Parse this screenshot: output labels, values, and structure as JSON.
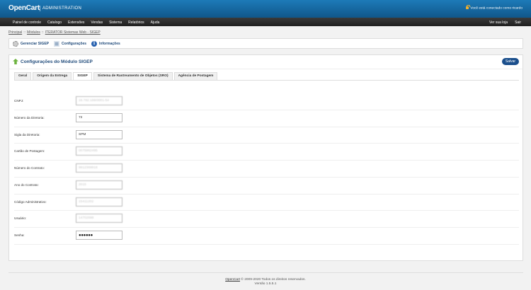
{
  "header": {
    "logo": "OpenCart",
    "subtitle": "ADMINISTRATION",
    "logged_in": "Você está conectado como ricardo"
  },
  "menu": {
    "items": [
      "Painel de controle",
      "Catalogo",
      "Extensões",
      "Vendas",
      "Sistema",
      "Relatórios",
      "Ajuda"
    ],
    "right": [
      "Ver sua loja",
      "Sair"
    ]
  },
  "breadcrumb": [
    "Principal",
    "Módulos",
    "ITERATOR Sistemas Web - SIGEP"
  ],
  "toolbar": {
    "items": [
      "Gerenciar SIGEP",
      "Configurações",
      "Informações"
    ]
  },
  "panel": {
    "title": "Configurações do Módulo SIGEP",
    "save_label": "Salvar"
  },
  "tabs": [
    "Geral",
    "Origem da Entrega",
    "SIGEP",
    "Sistema de Rastreamento de Objetos (SRO)",
    "Agência de Postagem"
  ],
  "active_tab": "SIGEP",
  "form": {
    "rows": [
      {
        "label": "CNPJ:",
        "value": "16.782.188/0001-54"
      },
      {
        "label": "Número da Diretoria:",
        "value": "72"
      },
      {
        "label": "Sigla da Diretoria:",
        "value": "SPM"
      },
      {
        "label": "Cartão de Postagem:",
        "value": "0075962495"
      },
      {
        "label": "Número do Contrato:",
        "value": "9912369918"
      },
      {
        "label": "Ano do Contrato:",
        "value": "2015"
      },
      {
        "label": "Código Administrativo:",
        "value": "15411202"
      },
      {
        "label": "Usuário:",
        "value": "14702698"
      },
      {
        "label": "Senha:",
        "value": "●●●●●●"
      }
    ]
  },
  "footer": {
    "brand": "OpenCart",
    "copyright": "© 2009-2020 Todos os direitos reservados.",
    "version": "Versão 1.5.5.1"
  },
  "colors": {
    "header": "#1469a3",
    "menu": "#2b2b2b",
    "accent": "#1b4f8c",
    "link": "#1f4a7a"
  }
}
